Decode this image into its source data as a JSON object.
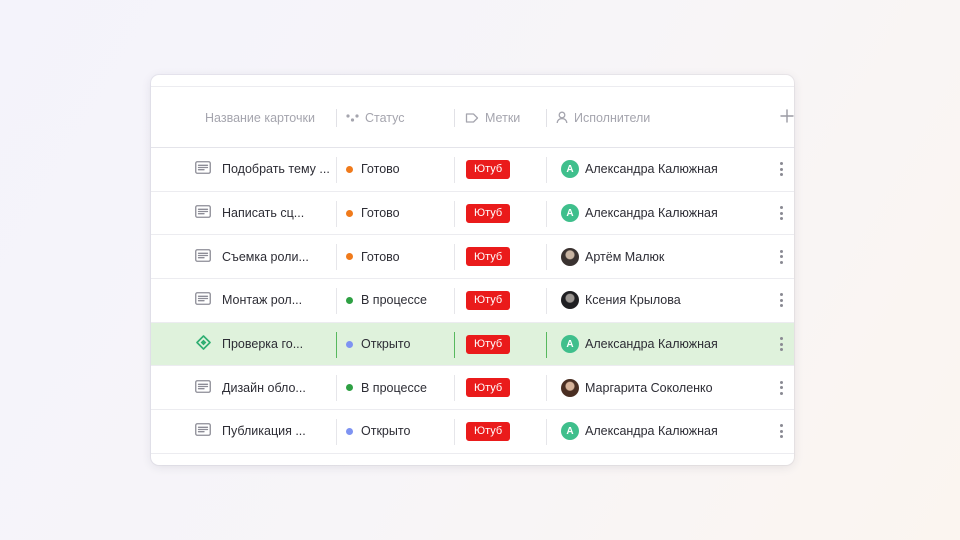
{
  "table": {
    "columns": {
      "name": "Название карточки",
      "status": "Статус",
      "tags": "Метки",
      "assignees": "Исполнители"
    },
    "colors": {
      "accent_green": "#3fbf8c",
      "selected_row": "#dff2dc",
      "tag_red": "#ea1b1b",
      "status_done": "#f07a1b",
      "status_in_progress": "#2ea043",
      "status_open": "#7e93f2"
    },
    "rows": [
      {
        "name": "Подобрать тему ...",
        "icon": "card-text-icon",
        "status": "Готово",
        "status_color": "#f07a1b",
        "tag": "Ютуб",
        "assignee": "Александра Калюжная",
        "avatar": "letter",
        "avatar_letter": "A"
      },
      {
        "name": "Написать сц...",
        "icon": "card-text-icon",
        "status": "Готово",
        "status_color": "#f07a1b",
        "tag": "Ютуб",
        "assignee": "Александра Калюжная",
        "avatar": "letter",
        "avatar_letter": "A"
      },
      {
        "name": "Съемка роли...",
        "icon": "card-text-icon",
        "status": "Готово",
        "status_color": "#f07a1b",
        "tag": "Ютуб",
        "assignee": "Артём Малюк",
        "avatar": "photo",
        "avatar_letter": ""
      },
      {
        "name": "Монтаж рол...",
        "icon": "card-text-icon",
        "status": "В процессе",
        "status_color": "#2ea043",
        "tag": "Ютуб",
        "assignee": "Ксения Крылова",
        "avatar": "photo2",
        "avatar_letter": ""
      },
      {
        "name": "Проверка го...",
        "icon": "diamond-icon",
        "status": "Открыто",
        "status_color": "#7e93f2",
        "tag": "Ютуб",
        "assignee": "Александра Калюжная",
        "avatar": "letter",
        "avatar_letter": "A",
        "selected": true
      },
      {
        "name": "Дизайн обло...",
        "icon": "card-text-icon",
        "status": "В процессе",
        "status_color": "#2ea043",
        "tag": "Ютуб",
        "assignee": "Маргарита Соколенко",
        "avatar": "photo3",
        "avatar_letter": ""
      },
      {
        "name": "Публикация ...",
        "icon": "card-text-icon",
        "status": "Открыто",
        "status_color": "#7e93f2",
        "tag": "Ютуб",
        "assignee": "Александра Калюжная",
        "avatar": "letter",
        "avatar_letter": "A"
      }
    ]
  }
}
